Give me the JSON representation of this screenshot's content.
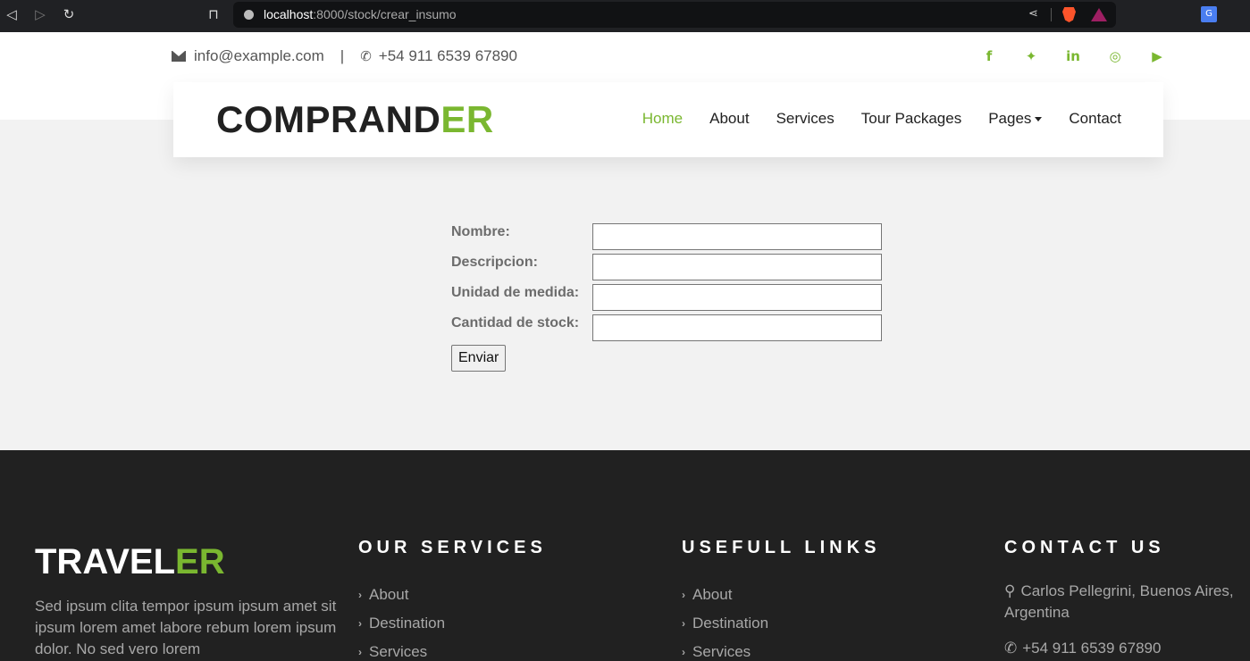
{
  "browser": {
    "url_host": "localhost",
    "url_path": ":8000/stock/crear_insumo"
  },
  "topbar": {
    "email": "info@example.com",
    "phone": "+54 911 6539 67890",
    "divider": "|",
    "socials": [
      "facebook-icon",
      "twitter-icon",
      "linkedin-icon",
      "instagram-icon",
      "youtube-icon"
    ]
  },
  "navbar": {
    "brand_main": "COMPRAND",
    "brand_accent": "ER",
    "items": [
      "Home",
      "About",
      "Services",
      "Tour Packages",
      "Pages",
      "Contact"
    ],
    "active": "Home"
  },
  "form": {
    "fields": [
      {
        "label": "Nombre:",
        "value": ""
      },
      {
        "label": "Descripcion:",
        "value": ""
      },
      {
        "label": "Unidad de medida:",
        "value": ""
      },
      {
        "label": "Cantidad de stock:",
        "value": ""
      }
    ],
    "submit_label": "Enviar"
  },
  "footer": {
    "brand_main": "TRAVEL",
    "brand_accent": "ER",
    "description": "Sed ipsum clita tempor ipsum ipsum amet sit ipsum lorem amet labore rebum lorem ipsum dolor. No sed vero lorem",
    "services_title": "OUR SERVICES",
    "services": [
      "About",
      "Destination",
      "Services"
    ],
    "links_title": "USEFULL LINKS",
    "links": [
      "About",
      "Destination",
      "Services"
    ],
    "contact_title": "CONTACT US",
    "address": "Carlos Pellegrini, Buenos Aires, Argentina",
    "phone": "+54 911 6539 67890"
  },
  "colors": {
    "accent": "#7ab730",
    "dark": "#212121",
    "footer_bg": "#212121"
  }
}
